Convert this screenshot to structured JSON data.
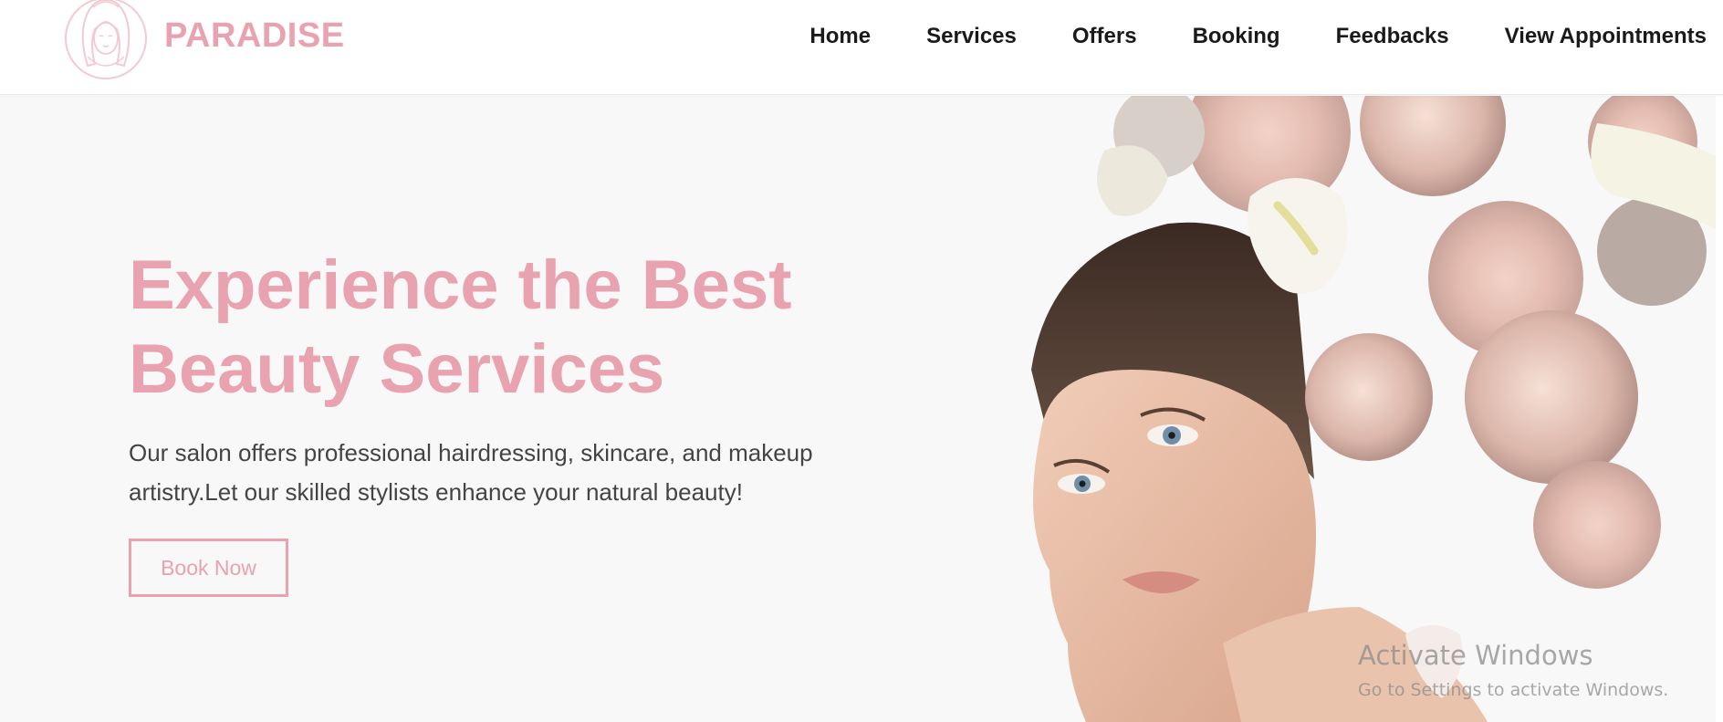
{
  "brand": {
    "name": "PARADISE",
    "logo_icon": "woman-face-logo-icon",
    "accent_color": "#e8a2b0"
  },
  "nav": {
    "items": [
      {
        "label": "Home"
      },
      {
        "label": "Services"
      },
      {
        "label": "Offers"
      },
      {
        "label": "Booking"
      },
      {
        "label": "Feedbacks"
      },
      {
        "label": "View Appointments"
      }
    ]
  },
  "hero": {
    "title": "Experience the Best Beauty Services",
    "description": "Our salon offers professional hairdressing, skincare, and makeup artistry.Let our skilled stylists enhance your natural beauty!",
    "cta_label": "Book Now",
    "image": "woman-with-flower-headdress-photo"
  },
  "watermark": {
    "title": "Activate Windows",
    "subtitle": "Go to Settings to activate Windows."
  }
}
